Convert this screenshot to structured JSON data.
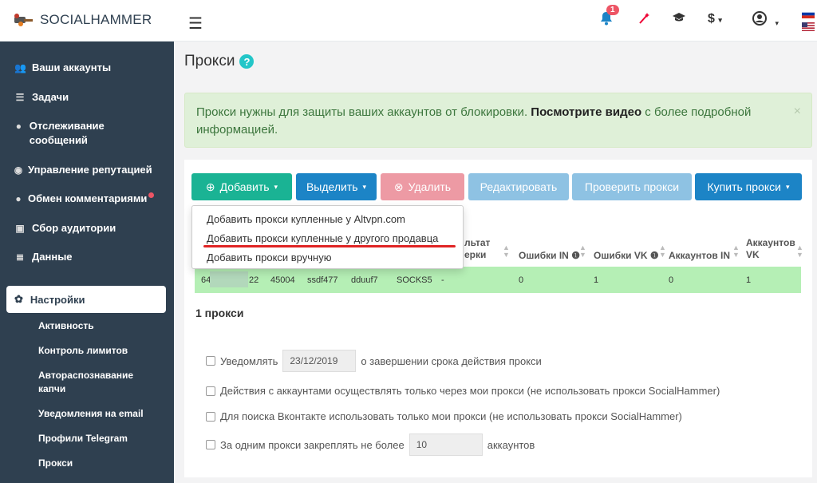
{
  "brand": {
    "name": "SOCIALHAMMER"
  },
  "topbar": {
    "notification_count": "1",
    "currency_label": "$",
    "icons": [
      "menu-icon",
      "bell-icon",
      "magic-wand-icon",
      "graduation-cap-icon",
      "dollar-icon",
      "user-circle-icon",
      "flag-ru-icon",
      "flag-us-icon"
    ]
  },
  "sidebar": {
    "items": [
      {
        "label": "Ваши аккаунты",
        "icon": "users-icon"
      },
      {
        "label": "Задачи",
        "icon": "tasks-icon"
      },
      {
        "label": "Отслеживание сообщений",
        "icon": "comment-icon"
      },
      {
        "label": "Управление репутацией",
        "icon": "eye-icon"
      },
      {
        "label": "Обмен комментариями",
        "icon": "comments-icon"
      },
      {
        "label": "Сбор аудитории",
        "icon": "id-card-icon"
      },
      {
        "label": "Данные",
        "icon": "database-icon"
      }
    ],
    "active": {
      "label": "Настройки",
      "icon": "gear-icon"
    },
    "sub_items": [
      {
        "label": "Активность"
      },
      {
        "label": "Контроль лимитов"
      },
      {
        "label": "Автораспознавание капчи"
      },
      {
        "label": "Уведомления на email"
      },
      {
        "label": "Профили Telegram"
      },
      {
        "label": "Прокси"
      }
    ]
  },
  "page": {
    "title": "Прокси",
    "alert": {
      "text_before": "Прокси нужны для защиты ваших аккаунтов от блокировки.",
      "link": "Посмотрите видео",
      "text_after": "с более подробной информацией."
    }
  },
  "toolbar": {
    "add": "Добавить",
    "select": "Выделить",
    "delete": "Удалить",
    "edit": "Редактировать",
    "check": "Проверить прокси",
    "buy": "Купить прокси"
  },
  "dropdown": {
    "items": [
      "Добавить прокси купленные у Altvpn.com",
      "Добавить прокси купленные у другого продавца",
      "Добавить прокси вручную"
    ]
  },
  "table": {
    "headers": [
      "льтат",
      "ерки",
      "Ошибки IN",
      "Ошибки VK",
      "Аккаунтов IN",
      "Аккаунтов",
      "VK"
    ],
    "row": [
      "64",
      "22",
      "45004",
      "ssdf477",
      "dduuf7",
      "SOCKS5",
      "-",
      "0",
      "1",
      "0",
      "1"
    ]
  },
  "summary": {
    "count": "1 прокси"
  },
  "options": {
    "notify_before": "Уведомлять",
    "notify_date": "23/12/2019",
    "notify_after": "о завершении срока действия прокси",
    "only_my_proxies": "Действия с аккаунтами осуществлять только через мои прокси (не использовать прокси SocialHammer)",
    "vk_search": "Для поиска Вконтакте использовать только мои прокси (не использовать прокси SocialHammer)",
    "limit_before": "За одним прокси закреплять не более",
    "limit_value": "10",
    "limit_after": "аккаунтов"
  },
  "colors": {
    "sidebar": "#2f4050",
    "primary": "#1ab394",
    "blue": "#1c84c6",
    "danger": "#ed5565"
  }
}
